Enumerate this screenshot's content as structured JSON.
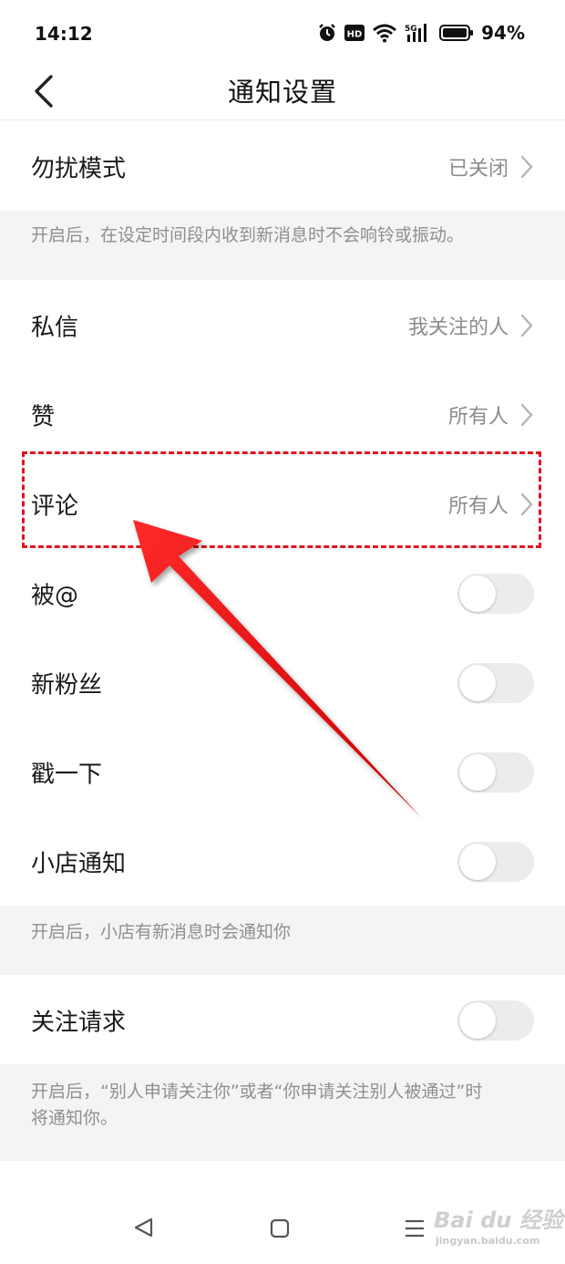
{
  "status_bar": {
    "time": "14:12",
    "network": "5G",
    "battery": "94%",
    "hd_badge": "HD"
  },
  "header": {
    "title": "通知设置"
  },
  "dnd": {
    "label": "勿扰模式",
    "value": "已关闭",
    "hint": "开启后，在设定时间段内收到新消息时不会响铃或振动。"
  },
  "items": {
    "private_message": {
      "label": "私信",
      "value": "我关注的人"
    },
    "likes": {
      "label": "赞",
      "value": "所有人"
    },
    "comments": {
      "label": "评论",
      "value": "所有人"
    },
    "mentions": {
      "label": "被@",
      "enabled": false
    },
    "new_fans": {
      "label": "新粉丝",
      "enabled": false
    },
    "poke": {
      "label": "戳一下",
      "enabled": false
    },
    "shop": {
      "label": "小店通知",
      "enabled": false,
      "hint": "开启后，小店有新消息时会通知你"
    },
    "follow_request": {
      "label": "关注请求",
      "enabled": false,
      "hint_line1": "开启后，“别人申请关注你”或者“你申请关注别人被通过”时",
      "hint_line2": "将通知你。"
    }
  },
  "annotation": {
    "color": "#e0141e",
    "target": "comments"
  },
  "watermark": {
    "main": "Bai du 经验",
    "sub": "jingyan.baidu.com"
  },
  "nav": {
    "back_icon": "triangle-back-icon",
    "home_icon": "square-home-icon",
    "menu_icon": "menu-lines-icon"
  }
}
